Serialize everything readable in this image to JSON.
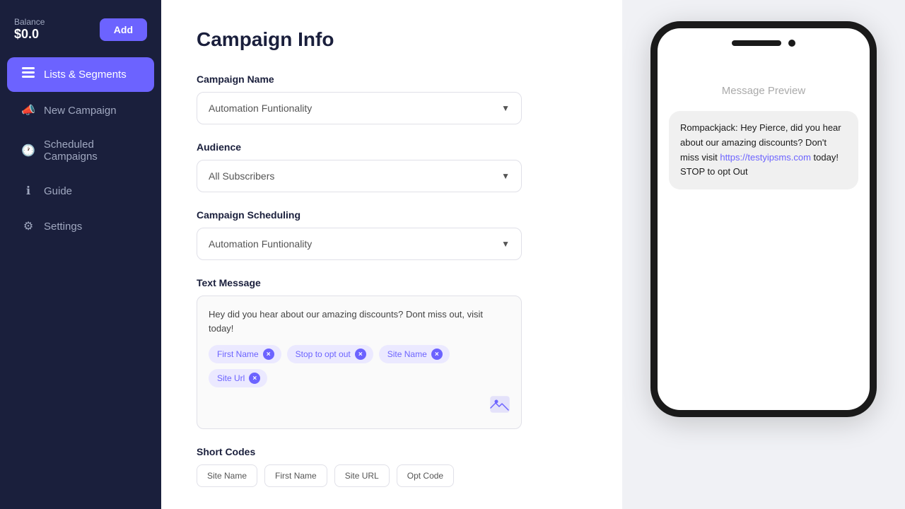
{
  "sidebar": {
    "balance_label": "Balance",
    "balance_amount": "$0.0",
    "add_button": "Add",
    "nav_items": [
      {
        "id": "lists-segments",
        "label": "Lists & Segments",
        "icon": "☰",
        "active": true
      },
      {
        "id": "new-campaign",
        "label": "New Campaign",
        "icon": "📣",
        "active": false
      },
      {
        "id": "scheduled-campaigns",
        "label": "Scheduled Campaigns",
        "icon": "🕐",
        "active": false
      },
      {
        "id": "guide",
        "label": "Guide",
        "icon": "ℹ",
        "active": false
      },
      {
        "id": "settings",
        "label": "Settings",
        "icon": "⚙",
        "active": false
      }
    ]
  },
  "main": {
    "page_title": "Campaign Info",
    "campaign_name_label": "Campaign Name",
    "campaign_name_value": "Automation Funtionality",
    "audience_label": "Audience",
    "audience_value": "All Subscribers",
    "campaign_scheduling_label": "Campaign Scheduling",
    "campaign_scheduling_value": "Automation Funtionality",
    "text_message_label": "Text Message",
    "message_text": "Hey did you hear about our amazing discounts? Dont miss out, visit today!",
    "tags": [
      {
        "label": "First Name"
      },
      {
        "label": "Stop to opt out"
      },
      {
        "label": "Site Name"
      },
      {
        "label": "Site Url"
      }
    ],
    "short_codes_label": "Short Codes",
    "short_codes": [
      "Site Name",
      "First Name",
      "Site URL",
      "Opt Code"
    ]
  },
  "preview": {
    "label": "Message Preview",
    "message_plain": "Rompackjack: Hey Pierce, did you hear about our amazing discounts? Don't miss visit ",
    "message_link": "https://testyipsms.com",
    "message_end": " today! STOP to opt Out"
  }
}
